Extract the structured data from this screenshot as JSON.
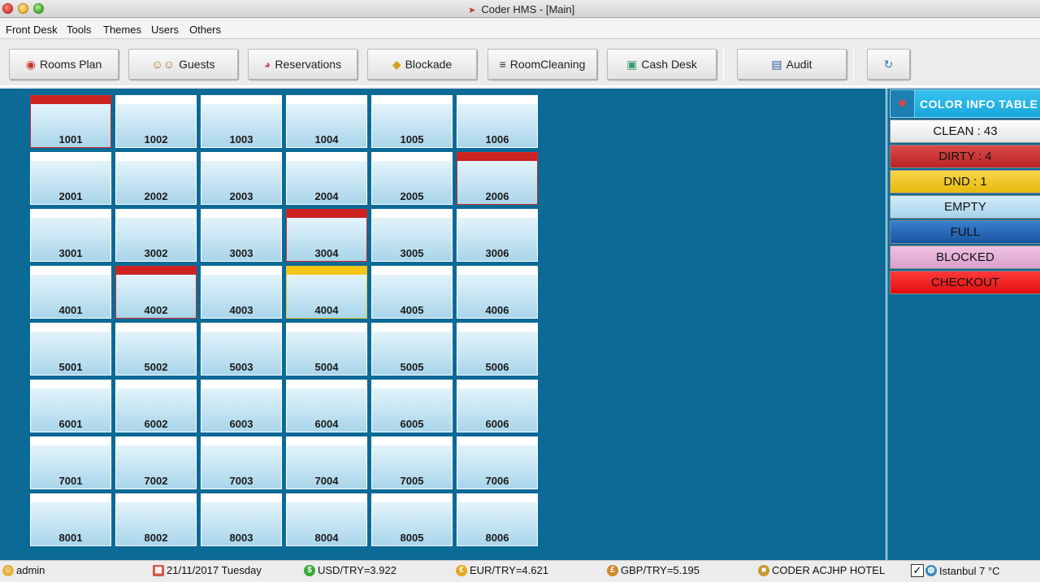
{
  "window": {
    "title": "Coder HMS - [Main]"
  },
  "menu": {
    "items": [
      "Front Desk",
      "Tools",
      "Themes",
      "Users",
      "Others"
    ]
  },
  "toolbar": {
    "rooms_plan": "Rooms Plan",
    "guests": "Guests",
    "reservations": "Reservations",
    "blockade": "Blockade",
    "room_cleaning": "RoomCleaning",
    "cash_desk": "Cash Desk",
    "audit": "Audit"
  },
  "colors": {
    "main_bg": "#0b6a96",
    "clean": "#f4f4f4",
    "dirty": "#cc2f2f",
    "dnd": "#f0c419",
    "empty": "#b7dcee",
    "full": "#1d5fb0",
    "blocked": "#e3a9d4",
    "checkout": "#ee1c1c"
  },
  "rooms": {
    "rows": [
      [
        {
          "n": "1001",
          "s": "dirty"
        },
        {
          "n": "1002",
          "s": "clean"
        },
        {
          "n": "1003",
          "s": "clean"
        },
        {
          "n": "1004",
          "s": "clean"
        },
        {
          "n": "1005",
          "s": "clean"
        },
        {
          "n": "1006",
          "s": "clean"
        }
      ],
      [
        {
          "n": "2001",
          "s": "clean"
        },
        {
          "n": "2002",
          "s": "clean"
        },
        {
          "n": "2003",
          "s": "clean"
        },
        {
          "n": "2004",
          "s": "clean"
        },
        {
          "n": "2005",
          "s": "clean"
        },
        {
          "n": "2006",
          "s": "dirty"
        }
      ],
      [
        {
          "n": "3001",
          "s": "clean"
        },
        {
          "n": "3002",
          "s": "clean"
        },
        {
          "n": "3003",
          "s": "clean"
        },
        {
          "n": "3004",
          "s": "dirty"
        },
        {
          "n": "3005",
          "s": "clean"
        },
        {
          "n": "3006",
          "s": "clean"
        }
      ],
      [
        {
          "n": "4001",
          "s": "clean"
        },
        {
          "n": "4002",
          "s": "dirty"
        },
        {
          "n": "4003",
          "s": "clean"
        },
        {
          "n": "4004",
          "s": "dnd"
        },
        {
          "n": "4005",
          "s": "clean"
        },
        {
          "n": "4006",
          "s": "clean"
        }
      ],
      [
        {
          "n": "5001",
          "s": "clean"
        },
        {
          "n": "5002",
          "s": "clean"
        },
        {
          "n": "5003",
          "s": "clean"
        },
        {
          "n": "5004",
          "s": "clean"
        },
        {
          "n": "5005",
          "s": "clean"
        },
        {
          "n": "5006",
          "s": "clean"
        }
      ],
      [
        {
          "n": "6001",
          "s": "clean"
        },
        {
          "n": "6002",
          "s": "clean"
        },
        {
          "n": "6003",
          "s": "clean"
        },
        {
          "n": "6004",
          "s": "clean"
        },
        {
          "n": "6005",
          "s": "clean"
        },
        {
          "n": "6006",
          "s": "clean"
        }
      ],
      [
        {
          "n": "7001",
          "s": "clean"
        },
        {
          "n": "7002",
          "s": "clean"
        },
        {
          "n": "7003",
          "s": "clean"
        },
        {
          "n": "7004",
          "s": "clean"
        },
        {
          "n": "7005",
          "s": "clean"
        },
        {
          "n": "7006",
          "s": "clean"
        }
      ],
      [
        {
          "n": "8001",
          "s": "clean"
        },
        {
          "n": "8002",
          "s": "clean"
        },
        {
          "n": "8003",
          "s": "clean"
        },
        {
          "n": "8004",
          "s": "clean"
        },
        {
          "n": "8005",
          "s": "clean"
        },
        {
          "n": "8006",
          "s": "clean"
        }
      ]
    ]
  },
  "color_info": {
    "title": "COLOR INFO TABLE",
    "clean": "CLEAN : 43",
    "dirty": "DIRTY : 4",
    "dnd": "DND : 1",
    "empty": "EMPTY",
    "full": "FULL",
    "blocked": "BLOCKED",
    "checkout": "CHECKOUT"
  },
  "status": {
    "user": "admin",
    "date": "21/11/2017 Tuesday",
    "usd": "USD/TRY=3.922",
    "eur": "EUR/TRY=4.621",
    "gbp": "GBP/TRY=5.195",
    "hotel": "CODER ACJHP HOTEL",
    "weather": "Istanbul 7 °C"
  }
}
